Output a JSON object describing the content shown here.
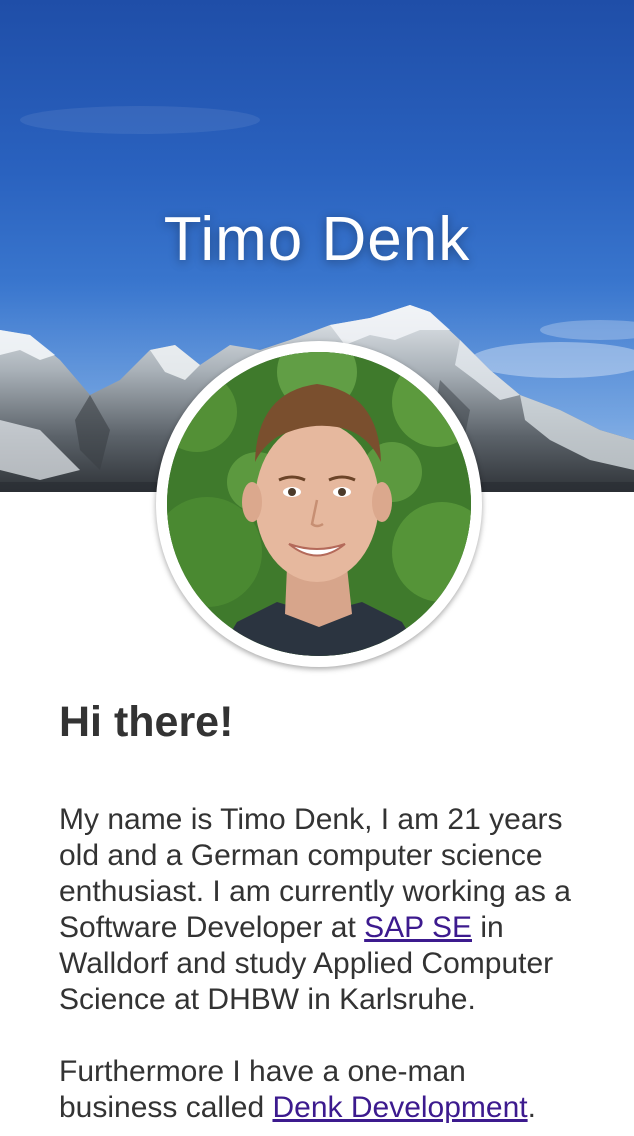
{
  "header": {
    "title": "Timo Denk",
    "background": "mountain-sky-photo",
    "avatar": "portrait-photo"
  },
  "intro": {
    "greeting": "Hi there!",
    "para1_before_link": "My name is Timo Denk, I am 21 years old and a German computer science enthusiast. I am currently working as a Software Developer at ",
    "para1_link": "SAP SE",
    "para1_after_link": " in Walldorf and study Applied Computer Science at DHBW in Karlsruhe.",
    "para2_before_link": "Furthermore I have a one-man business called ",
    "para2_link": "Denk Development",
    "para2_after_link": "."
  },
  "colors": {
    "text": "#333333",
    "link": "#3c1a8e",
    "sky": "#2a62bf"
  }
}
